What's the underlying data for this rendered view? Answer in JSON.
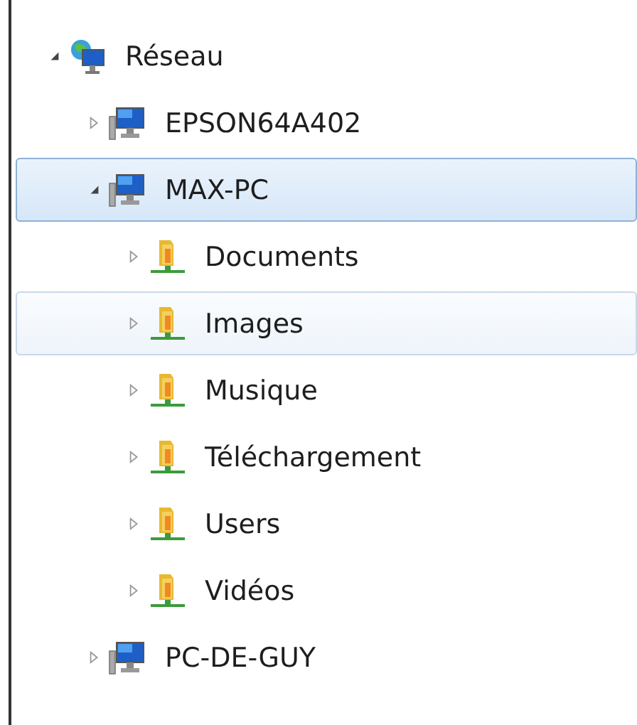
{
  "tree": [
    {
      "kind": "network",
      "label": "Réseau",
      "expanded": true,
      "selected": false,
      "hovered": false,
      "children": [
        {
          "kind": "computer",
          "label": "EPSON64A402",
          "expanded": false,
          "selected": false,
          "hovered": false
        },
        {
          "kind": "computer",
          "label": "MAX-PC",
          "expanded": true,
          "selected": true,
          "hovered": false,
          "children": [
            {
              "kind": "folder",
              "label": "Documents",
              "expanded": false,
              "selected": false,
              "hovered": false
            },
            {
              "kind": "folder",
              "label": "Images",
              "expanded": false,
              "selected": false,
              "hovered": true
            },
            {
              "kind": "folder",
              "label": "Musique",
              "expanded": false,
              "selected": false,
              "hovered": false
            },
            {
              "kind": "folder",
              "label": "Téléchargement",
              "expanded": false,
              "selected": false,
              "hovered": false
            },
            {
              "kind": "folder",
              "label": "Users",
              "expanded": false,
              "selected": false,
              "hovered": false
            },
            {
              "kind": "folder",
              "label": "Vidéos",
              "expanded": false,
              "selected": false,
              "hovered": false
            }
          ]
        },
        {
          "kind": "computer",
          "label": "PC-DE-GUY",
          "expanded": false,
          "selected": false,
          "hovered": false
        }
      ]
    }
  ]
}
